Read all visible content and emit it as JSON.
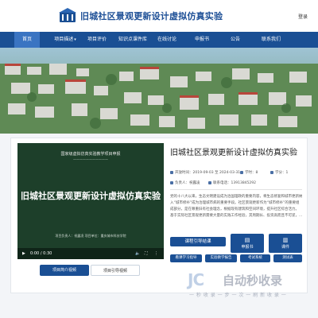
{
  "header": {
    "site_title": "旧城社区景观更新设计虚拟仿真实验",
    "login": "登录"
  },
  "nav": {
    "items": [
      {
        "label": "首页",
        "active": true
      },
      {
        "label": "项目描述",
        "has_dropdown": true
      },
      {
        "label": "项目评价"
      },
      {
        "label": "知识点课件库"
      },
      {
        "label": "在线讨论"
      },
      {
        "label": "申报书"
      },
      {
        "label": "公告"
      },
      {
        "label": "联系我们"
      }
    ]
  },
  "video": {
    "header_line": "国家级虚拟仿真实验教学项目申报",
    "sub_line": "———————————",
    "title": "旧城社区景观更新设计虚拟仿真实验",
    "credit": "项目负责人：祝露凌  项目单位：重庆城市科技学院",
    "time": "0:00 / 0:30",
    "play_icon": "play-icon",
    "volume_icon": "volume-icon",
    "fullscreen_icon": "fullscreen-icon",
    "more_icon": "more-icon"
  },
  "tabs": {
    "primary": "项目简介视频",
    "secondary": "项目引导视频"
  },
  "project": {
    "title": "旧城社区景观更新设计虚拟仿真实验",
    "star_icon": "star-outline-icon",
    "open_time": "开放时间：2019-09-03 至 2024-03-31",
    "credits": "学时：8",
    "score": "学分：1",
    "leader": "负责人：祝露凌",
    "phone": "联系电话：13913845292",
    "description": [
      "党的十八大以来，生态文明建设成为治国理政的重要内容，将生态修复和城市更新纳",
      "入“城市修补”成为治理城市病的重要手段。社区景观更新作为“城市修补”的重要组",
      "成部分，是在尊重旧有社会理念，根据现有建筑和空间环境，提升社区综合活力。",
      "基于实际社区景观更新需要大量的实践工作经验，其周期长、投资高而且不可逆，..."
    ]
  },
  "actions": {
    "start": "课程引导结课",
    "apply": "申报书",
    "guide": "课件",
    "learn": "看课学习指导",
    "lab": "实验教学报告",
    "exam": "考试系统",
    "test": "测试表"
  },
  "watermark": {
    "logo": "JC",
    "name": "自动秒收录",
    "sub": "一 秒 收 录 一 步 一 次 一 刷 新 收 录 一"
  },
  "colors": {
    "primary": "#1a4f94",
    "nav_active": "#3a74c2",
    "title": "#1d4f96"
  }
}
